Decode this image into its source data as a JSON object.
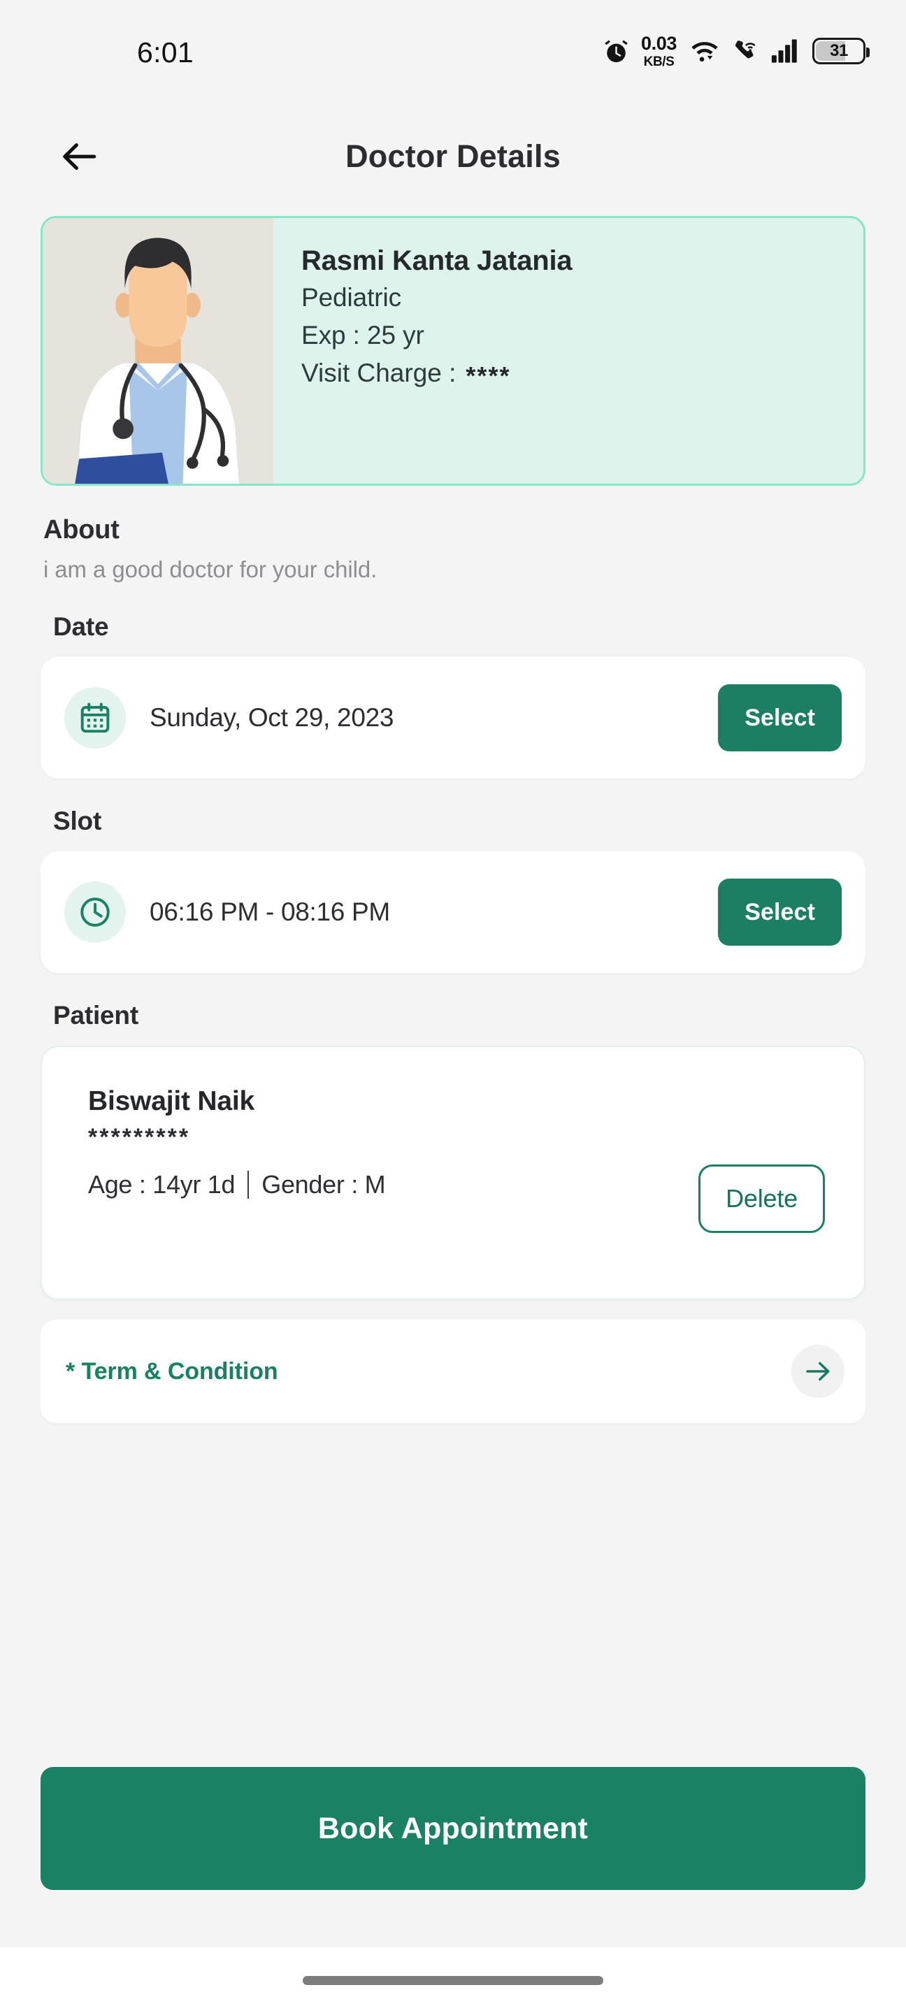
{
  "status_bar": {
    "time": "6:01",
    "net_speed_value": "0.03",
    "net_speed_unit": "KB/S",
    "battery_level": "31",
    "icons": [
      "alarm-icon",
      "wifi-icon",
      "vowifi-call-icon",
      "cellular-signal-icon",
      "battery-icon"
    ]
  },
  "app_bar": {
    "back_icon": "arrow-left-icon",
    "title": "Doctor Details"
  },
  "doctor": {
    "name": "Rasmi Kanta Jatania",
    "specialty": "Pediatric",
    "experience": "Exp : 25 yr",
    "visit_charge_label": "Visit Charge :",
    "visit_charge_value": "****",
    "photo_alt": "doctor-illustration"
  },
  "about": {
    "title": "About",
    "text": "i am a good doctor for your child."
  },
  "date_section": {
    "label": "Date",
    "icon": "calendar-icon",
    "value": "Sunday, Oct 29, 2023",
    "select_label": "Select"
  },
  "slot_section": {
    "label": "Slot",
    "icon": "clock-icon",
    "value": "06:16 PM - 08:16 PM",
    "select_label": "Select"
  },
  "patient_section": {
    "label": "Patient",
    "name": "Biswajit Naik",
    "masked_value": "*********",
    "age": "Age : 14yr 1d",
    "gender": "Gender : M",
    "delete_label": "Delete"
  },
  "terms": {
    "label": "* Term & Condition",
    "arrow_icon": "arrow-right-icon"
  },
  "primary_action": {
    "label": "Book Appointment"
  },
  "colors": {
    "brand_green": "#1a8165",
    "brand_green_dark": "#16735a",
    "card_mint_bg": "#def3ec",
    "card_mint_border": "#85e6c8",
    "icon_circle_bg": "#e2f4ed",
    "page_bg": "#f4f4f4",
    "card_white": "#ffffff",
    "text_primary": "#2c2c31",
    "text_muted": "#8e8e93"
  }
}
